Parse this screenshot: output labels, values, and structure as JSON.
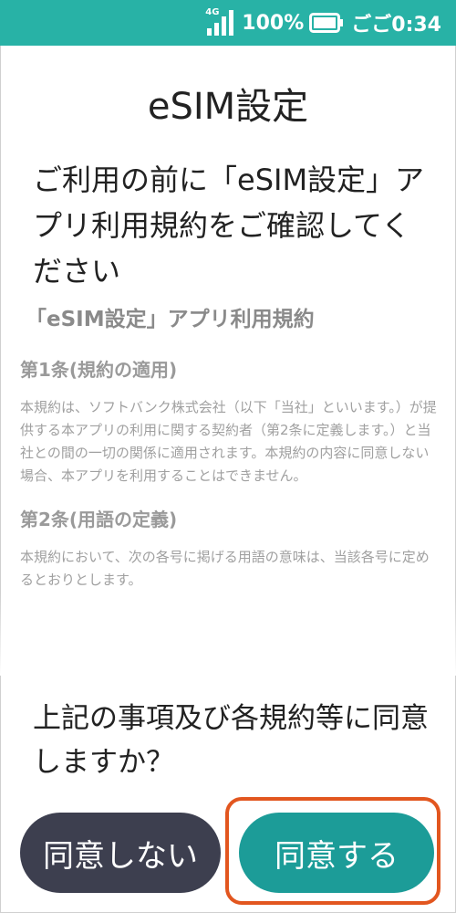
{
  "status_bar": {
    "network_type": "4G",
    "battery_percent": "100%",
    "time": "ごご0:34",
    "icons": [
      "signal-icon",
      "battery-icon"
    ],
    "background_color": "#28b2a6"
  },
  "page": {
    "title": "eSIM設定",
    "heading": "ご利用の前に「eSIM設定」アプリ利用規約をご確認してください"
  },
  "terms": {
    "title": "「eSIM設定」アプリ利用規約",
    "articles": [
      {
        "title": "第1条(規約の適用)",
        "body": "本規約は、ソフトバンク株式会社（以下「当社」といいます。）が提供する本アプリの利用に関する契約者（第2条に定義します。）と当社との間の一切の関係に適用されます。本規約の内容に同意しない場合、本アプリを利用することはできません。"
      },
      {
        "title": "第2条(用語の定義)",
        "body": "本規約において、次の各号に掲げる用語の意味は、当該各号に定めるとおりとします。"
      }
    ]
  },
  "confirm": {
    "question": "上記の事項及び各規約等に同意しますか？",
    "decline_label": "同意しない",
    "agree_label": "同意する",
    "decline_color": "#3d3f4f",
    "agree_color": "#1c9c98",
    "highlight_color": "#e2561f"
  }
}
